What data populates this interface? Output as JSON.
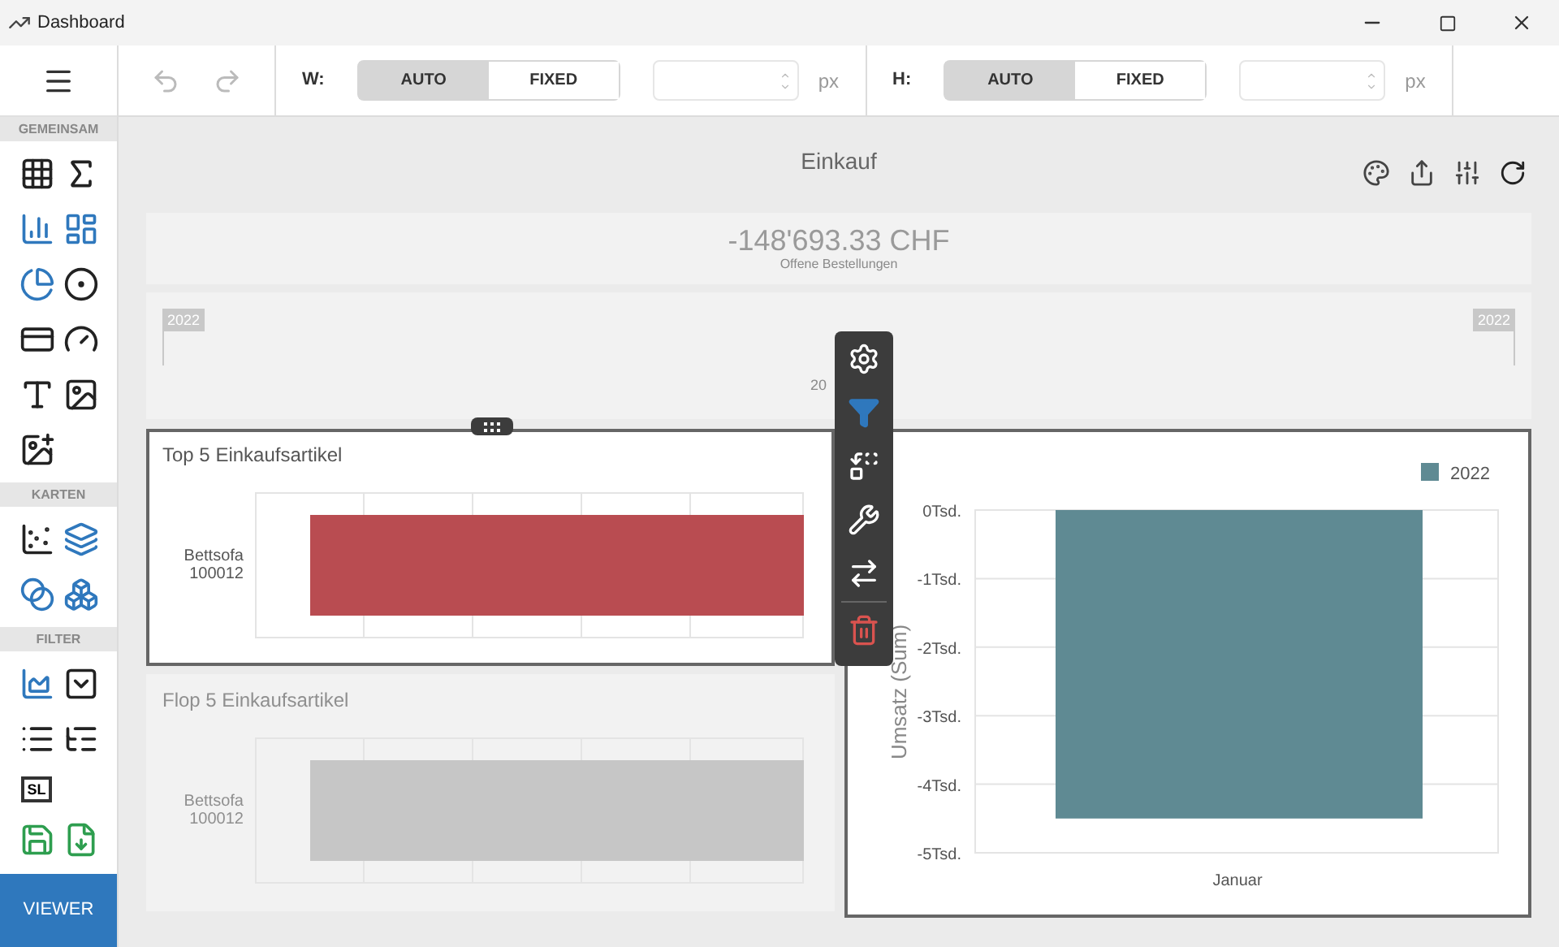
{
  "window": {
    "title": "Dashboard"
  },
  "toolbar": {
    "size_controls": [
      {
        "label": "W:",
        "options": [
          {
            "label": "AUTO",
            "selected": true
          },
          {
            "label": "FIXED",
            "selected": false
          }
        ],
        "unit": "px"
      },
      {
        "label": "H:",
        "options": [
          {
            "label": "AUTO",
            "selected": true
          },
          {
            "label": "FIXED",
            "selected": false
          }
        ],
        "unit": "px"
      }
    ]
  },
  "sidebar": {
    "sections": [
      {
        "title": "GEMEINSAM"
      },
      {
        "title": "KARTEN"
      },
      {
        "title": "FILTER",
        "text_icon": "SL"
      }
    ],
    "viewer_button": "VIEWER"
  },
  "dashboard": {
    "title": "Einkauf",
    "kpi": {
      "value": "-148'693.33 CHF",
      "label": "Offene Bestellungen"
    },
    "range_filter": {
      "start_label": "2022",
      "end_label": "2022",
      "center_label": "20"
    },
    "bar_panels": [
      {
        "title": "Top 5 Einkaufsartikel",
        "category": "Bettsofa\n100012",
        "selected": true
      },
      {
        "title": "Flop 5 Einkaufsartikel",
        "category": "Bettsofa\n100012",
        "selected": false
      }
    ],
    "main_chart": {
      "selected": true,
      "chart_data": {
        "type": "bar",
        "ylabel": "Umsatz (Sum)",
        "categories": [
          "Januar"
        ],
        "series": [
          {
            "name": "2022",
            "color": "#5f8a93",
            "values": [
              -4.5
            ]
          }
        ],
        "ylim": [
          -5,
          0
        ],
        "grid": true,
        "yticks": [
          {
            "value": 0,
            "label": "0Tsd."
          },
          {
            "value": -1,
            "label": "-1Tsd."
          },
          {
            "value": -2,
            "label": "-2Tsd."
          },
          {
            "value": -3,
            "label": "-3Tsd."
          },
          {
            "value": -4,
            "label": "-4Tsd."
          },
          {
            "value": -5,
            "label": "-5Tsd."
          }
        ]
      }
    }
  }
}
